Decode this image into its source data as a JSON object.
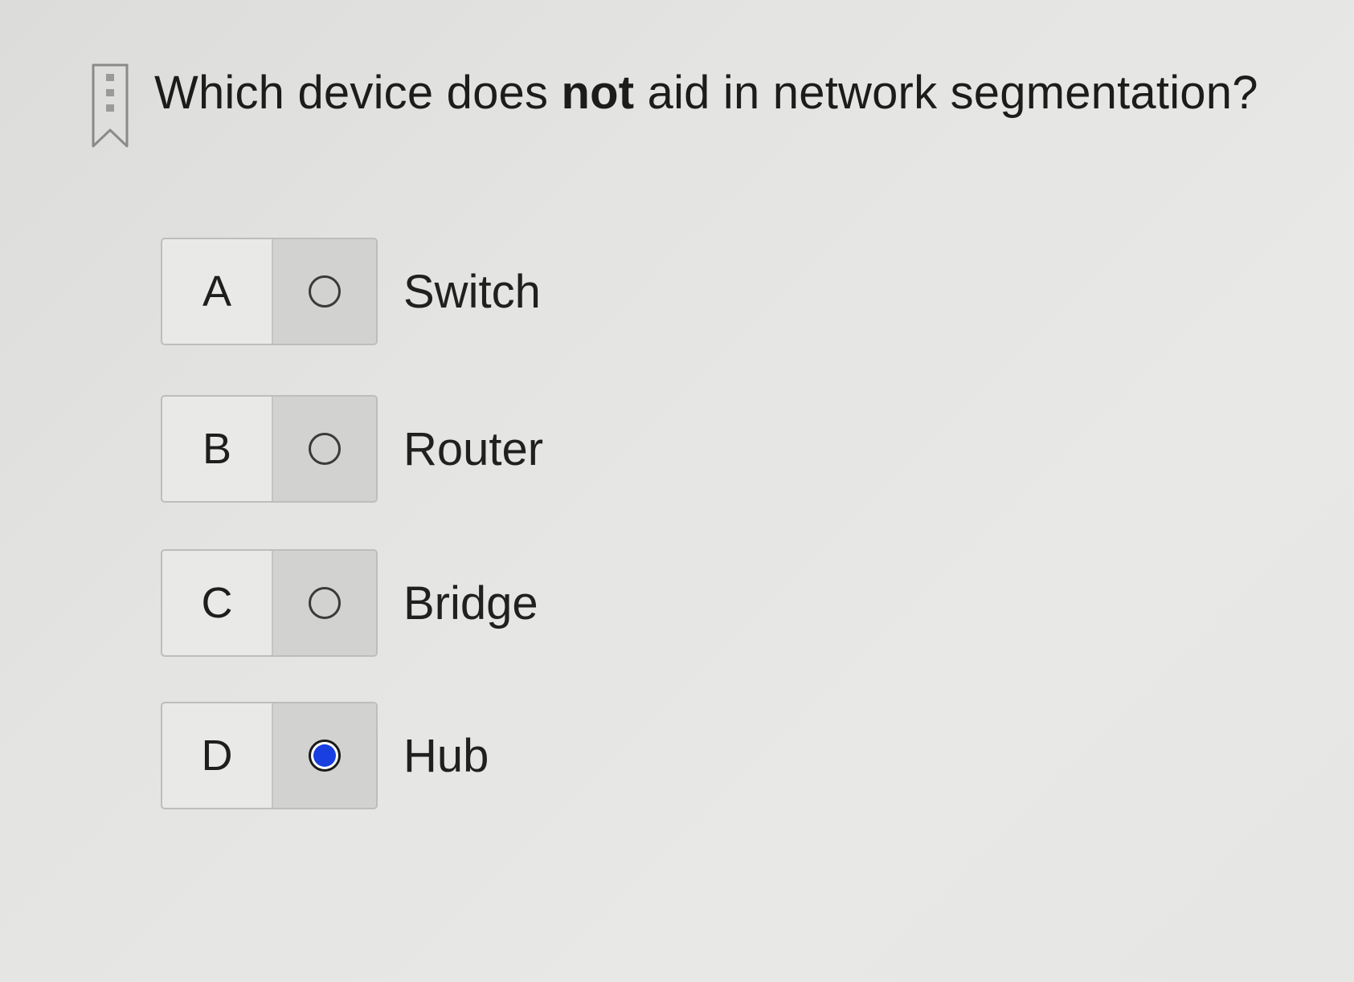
{
  "question": {
    "text_before": "Which device does ",
    "emphasis": "not",
    "text_after": " aid in network segmentation?"
  },
  "options": [
    {
      "letter": "A",
      "label": "Switch",
      "selected": false
    },
    {
      "letter": "B",
      "label": "Router",
      "selected": false
    },
    {
      "letter": "C",
      "label": "Bridge",
      "selected": false
    },
    {
      "letter": "D",
      "label": "Hub",
      "selected": true
    }
  ],
  "icons": {
    "bookmark": "bookmark-icon",
    "radio_unselected": "radio-unselected-icon",
    "radio_selected": "radio-selected-icon"
  },
  "colors": {
    "selected_accent": "#1a3fe0"
  }
}
